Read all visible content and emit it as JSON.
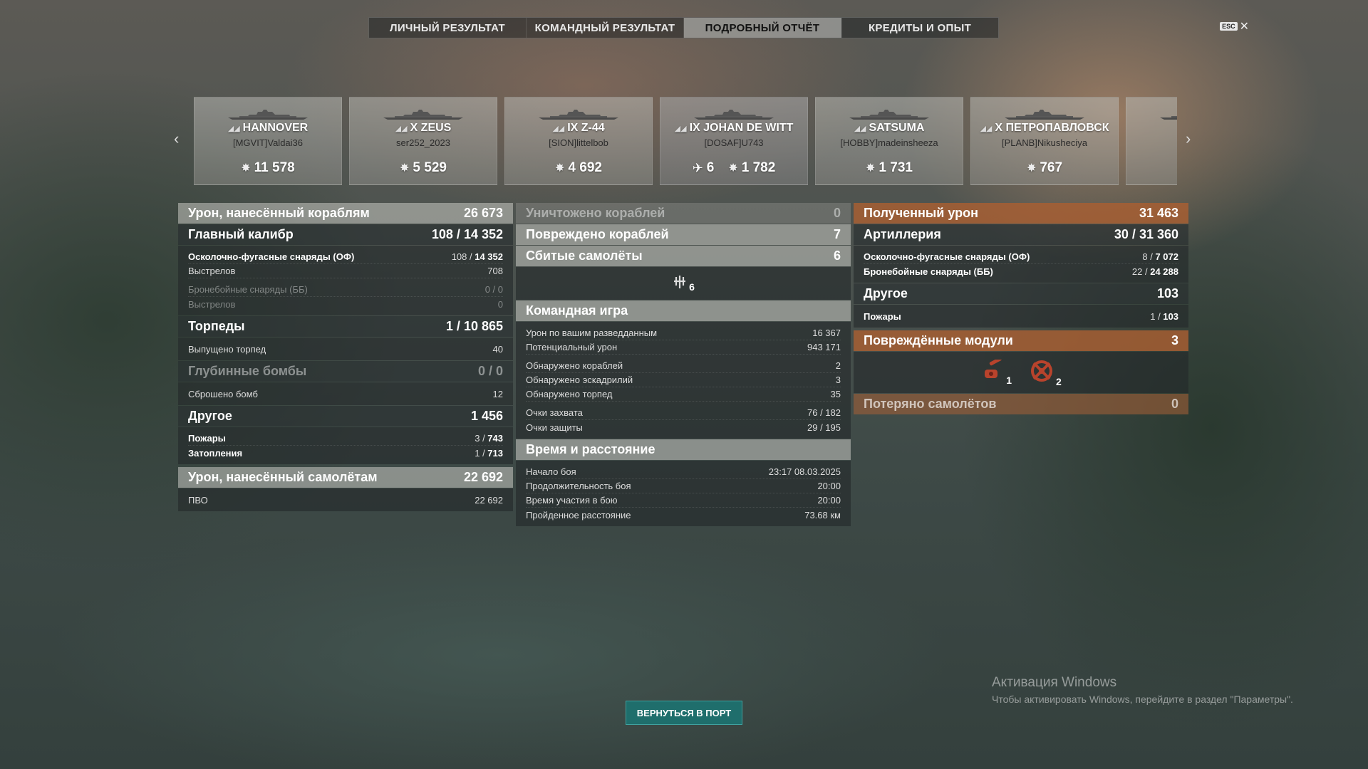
{
  "tabs": [
    {
      "label": "ЛИЧНЫЙ РЕЗУЛЬТАТ",
      "active": false
    },
    {
      "label": "КОМАНДНЫЙ РЕЗУЛЬТАТ",
      "active": false
    },
    {
      "label": "ПОДРОБНЫЙ ОТЧЁТ",
      "active": true
    },
    {
      "label": "КРЕДИТЫ И ОПЫТ",
      "active": false
    }
  ],
  "esc_label": "ESC",
  "cards": [
    {
      "ship": "HANNOVER",
      "player": "[MGVIT]Valdai36",
      "damage": "11 578"
    },
    {
      "ship": "X ZEUS",
      "player": "ser252_2023",
      "damage": "5 529"
    },
    {
      "ship": "IX Z-44",
      "player": "[SION]littelbob",
      "damage": "4 692"
    },
    {
      "ship": "IX JOHAN DE WITT",
      "player": "[DOSAF]U743",
      "planes": "6",
      "damage": "1 782"
    },
    {
      "ship": "SATSUMA",
      "player": "[HOBBY]madeinsheeza",
      "damage": "1 731"
    },
    {
      "ship": "X ПЕТРОПАВЛОВСК",
      "player": "[PLANB]Nikusheciya",
      "damage": "767"
    },
    {
      "ship": "",
      "player": "[SEN",
      "damage": ""
    }
  ],
  "left": {
    "dmg_ships": {
      "label": "Урон, нанесённый кораблям",
      "value": "26 673"
    },
    "main_battery": {
      "label": "Главный калибр",
      "hits": "108",
      "value": "14 352"
    },
    "he": {
      "label": "Осколочно-фугасные снаряды (ОФ)",
      "hits": "108",
      "value": "14 352"
    },
    "he_shots": {
      "label": "Выстрелов",
      "value": "708"
    },
    "ap": {
      "label": "Бронебойные снаряды (ББ)",
      "value": "0 / 0"
    },
    "ap_shots": {
      "label": "Выстрелов",
      "value": "0"
    },
    "torps": {
      "label": "Торпеды",
      "hits": "1",
      "value": "10 865"
    },
    "torps_launched": {
      "label": "Выпущено торпед",
      "value": "40"
    },
    "depth": {
      "label": "Глубинные бомбы",
      "value": "0 / 0"
    },
    "bombs_dropped": {
      "label": "Сброшено бомб",
      "value": "12"
    },
    "other": {
      "label": "Другое",
      "value": "1 456"
    },
    "fires": {
      "label": "Пожары",
      "hits": "3",
      "value": "743"
    },
    "floods": {
      "label": "Затопления",
      "hits": "1",
      "value": "713"
    },
    "dmg_planes": {
      "label": "Урон, нанесённый самолётам",
      "value": "22 692"
    },
    "aa": {
      "label": "ПВО",
      "value": "22 692"
    }
  },
  "mid": {
    "destroyed": {
      "label": "Уничтожено кораблей",
      "value": "0"
    },
    "damaged": {
      "label": "Повреждено кораблей",
      "value": "7"
    },
    "planes_shot": {
      "label": "Сбитые самолёты",
      "value": "6"
    },
    "planes_icon_count": "6",
    "team": {
      "label": "Командная игра"
    },
    "spot_dmg": {
      "label": "Урон по вашим разведданным",
      "value": "16 367"
    },
    "potential": {
      "label": "Потенциальный урон",
      "value": "943 171"
    },
    "spot_ships": {
      "label": "Обнаружено кораблей",
      "value": "2"
    },
    "spot_sq": {
      "label": "Обнаружено эскадрилий",
      "value": "3"
    },
    "spot_torps": {
      "label": "Обнаружено торпед",
      "value": "35"
    },
    "capture": {
      "label": "Очки захвата",
      "value": "76 / 182"
    },
    "defense": {
      "label": "Очки защиты",
      "value": "29 / 195"
    },
    "time": {
      "label": "Время и расстояние"
    },
    "start": {
      "label": "Начало боя",
      "value": "23:17  08.03.2025"
    },
    "duration": {
      "label": "Продолжительность боя",
      "value": "20:00"
    },
    "participation": {
      "label": "Время участия в бою",
      "value": "20:00"
    },
    "distance": {
      "label": "Пройденное расстояние",
      "value": "73.68 км"
    }
  },
  "right": {
    "received": {
      "label": "Полученный урон",
      "value": "31 463"
    },
    "artillery": {
      "label": "Артиллерия",
      "hits": "30",
      "value": "31 360"
    },
    "he": {
      "label": "Осколочно-фугасные снаряды (ОФ)",
      "hits": "8",
      "value": "7 072"
    },
    "ap": {
      "label": "Бронебойные снаряды (ББ)",
      "hits": "22",
      "value": "24 288"
    },
    "other": {
      "label": "Другое",
      "value": "103"
    },
    "fires": {
      "label": "Пожары",
      "hits": "1",
      "value": "103"
    },
    "modules": {
      "label": "Повреждённые модули",
      "value": "3"
    },
    "module_icons": [
      {
        "count": "1"
      },
      {
        "count": "2"
      }
    ],
    "planes_lost": {
      "label": "Потеряно самолётов",
      "value": "0"
    }
  },
  "return_button": "ВЕРНУТЬСЯ В ПОРТ",
  "windows": {
    "title": "Активация Windows",
    "text": "Чтобы активировать Windows, перейдите в раздел \"Параметры\"."
  }
}
